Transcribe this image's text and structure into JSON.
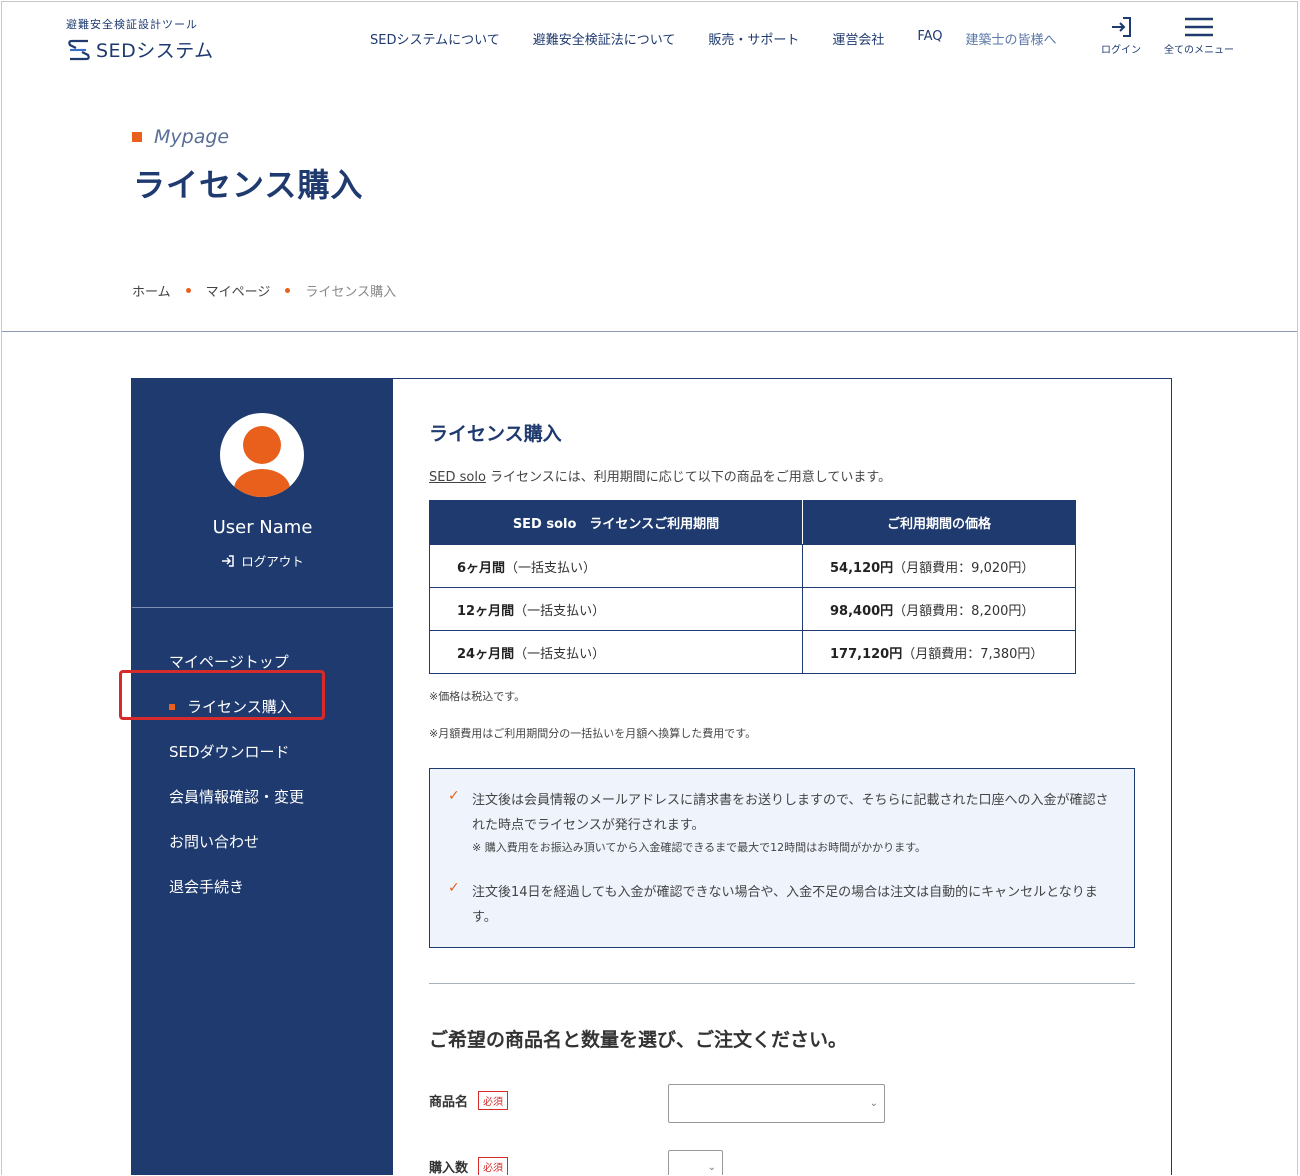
{
  "header": {
    "logo_sub": "避難安全検証設計ツール",
    "logo_text": "SEDシステム",
    "nav": [
      {
        "label": "SEDシステムについて"
      },
      {
        "label": "避難安全検証法について"
      },
      {
        "label": "販売・サポート"
      },
      {
        "label": "運営会社"
      },
      {
        "label": "FAQ"
      },
      {
        "label": "建築士の皆様へ"
      }
    ],
    "login_label": "ログイン",
    "menu_label": "全てのメニュー"
  },
  "title": {
    "eyebrow": "Mypage",
    "page_title": "ライセンス購入"
  },
  "breadcrumb": [
    "ホーム",
    "マイページ",
    "ライセンス購入"
  ],
  "sidebar": {
    "username": "User Name",
    "logout": "ログアウト",
    "menu": [
      {
        "label": "マイページトップ"
      },
      {
        "label": "ライセンス購入",
        "active": true
      },
      {
        "label": "SEDダウンロード"
      },
      {
        "label": "会員情報確認・変更"
      },
      {
        "label": "お問い合わせ"
      },
      {
        "label": "退会手続き"
      }
    ]
  },
  "main": {
    "title": "ライセンス購入",
    "intro_link": "SED solo",
    "intro_rest": " ライセンスには、利用期間に応じて以下の商品をご用意しています。",
    "table": {
      "headers": [
        "SED solo　ライセンスご利用期間",
        "ご利用期間の価格"
      ],
      "rows": [
        {
          "period": "6ヶ月間",
          "period_note": "（一括支払い）",
          "price": "54,120円",
          "price_note": "（月額費用：9,020円）"
        },
        {
          "period": "12ヶ月間",
          "period_note": "（一括支払い）",
          "price": "98,400円",
          "price_note": "（月額費用：8,200円）"
        },
        {
          "period": "24ヶ月間",
          "period_note": "（一括支払い）",
          "price": "177,120円",
          "price_note": "（月額費用：7,380円）"
        }
      ]
    },
    "note1": "※価格は税込です。",
    "note2": "※月額費用はご利用期間分の一括払いを月額へ換算した費用です。",
    "info": {
      "item1": "注文後は会員情報のメールアドレスに請求書をお送りしますので、そちらに記載された口座への入金が確認された時点でライセンスが発行されます。",
      "item1_small": "※ 購入費用をお振込み頂いてから入金確認できるまで最大で12時間はお時間がかかります。",
      "item2": "注文後14日を経過しても入金が確認できない場合や、入金不足の場合は注文は自動的にキャンセルとなります。"
    },
    "order_title": "ご希望の商品名と数量を選び、ご注文ください。",
    "product_label": "商品名",
    "quantity_label": "購入数",
    "required": "必須",
    "product_value": "",
    "quantity_value": ""
  },
  "colors": {
    "navy": "#1e3a6e",
    "accent": "#e8601c",
    "highlight": "#d72a2a"
  }
}
